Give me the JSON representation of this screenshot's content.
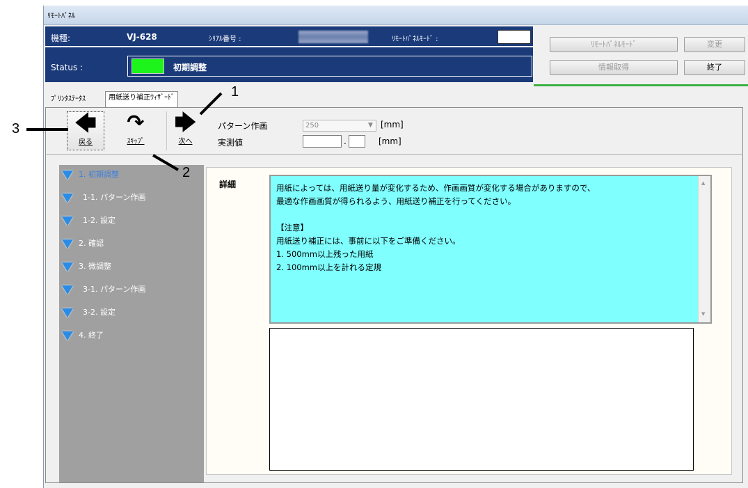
{
  "window": {
    "title": "ﾘﾓｰﾄﾊﾟﾈﾙ"
  },
  "header": {
    "model_label": "機種:",
    "model_value": "VJ-628",
    "serial_label": "ｼﾘｱﾙ番号 :",
    "remote_mode_label": "ﾘﾓｰﾄﾊﾟﾈﾙﾓｰﾄﾞ :",
    "status_label": "Status :",
    "status_text": "初期調整",
    "status_color": "#1cf41c"
  },
  "buttons": {
    "remote_mode": "ﾘﾓｰﾄﾊﾟﾈﾙﾓｰﾄﾞ",
    "change": "変更",
    "get_info": "情報取得",
    "exit": "終了"
  },
  "tabs": [
    {
      "label": "ﾌﾟﾘﾝﾀｽﾃｰﾀｽ",
      "active": false
    },
    {
      "label": "用紙送り補正ｳｨｻﾞｰﾄﾞ",
      "active": true
    }
  ],
  "nav": {
    "back": {
      "label": "戻る",
      "icon": "arrow-left-icon"
    },
    "skip": {
      "label": "ｽｷｯﾌﾟ",
      "icon": "skip-curved-arrow-icon"
    },
    "next": {
      "label": "次へ",
      "icon": "arrow-right-icon"
    }
  },
  "form": {
    "pattern_label": "パターン作画",
    "pattern_value": "250",
    "pattern_unit": "[mm]",
    "measured_label": "実測値",
    "measured_integer": "",
    "measured_decimal": "",
    "decimal_point": ".",
    "measured_unit": "[mm]"
  },
  "steps": [
    {
      "label": "1. 初期調整",
      "active": true
    },
    {
      "label": "1-1. パターン作画",
      "active": false
    },
    {
      "label": "1-2. 設定",
      "active": false
    },
    {
      "label": "2. 確認",
      "active": false
    },
    {
      "label": "3. 微調整",
      "active": false
    },
    {
      "label": "3-1. パターン作画",
      "active": false
    },
    {
      "label": "3-2. 設定",
      "active": false
    },
    {
      "label": "4. 終了",
      "active": false
    }
  ],
  "detail": {
    "label": "詳細",
    "text": "用紙によっては、用紙送り量が変化するため、作画画質が変化する場合がありますので、\n最適な作画画質が得られるよう、用紙送り補正を行ってください。\n\n【注意】\n用紙送り補正には、事前に以下をご準備ください。\n1. 500mm以上残った用紙\n2. 100mm以上を計れる定規",
    "bg_color": "#80ffff"
  },
  "callouts": {
    "c1": "1",
    "c2": "2",
    "c3": "3"
  },
  "colors": {
    "header_bg": "#1a3a7a",
    "active_step": "#3a7fe0"
  }
}
